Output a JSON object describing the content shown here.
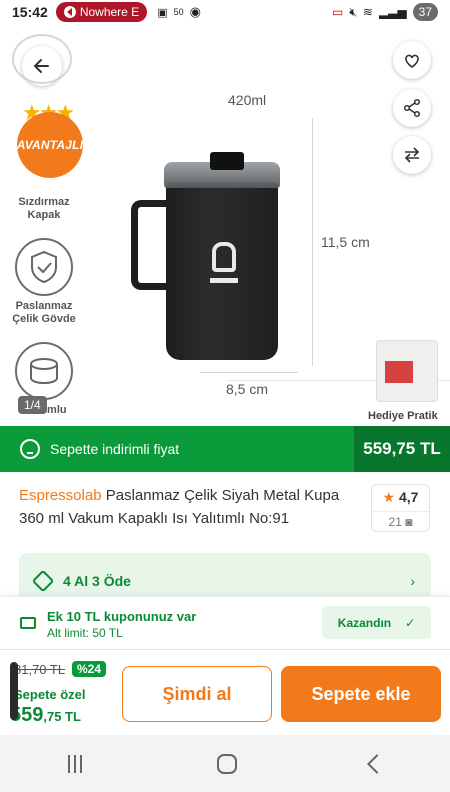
{
  "status": {
    "time": "15:42",
    "media_pill": "Nowhere E",
    "badge_50": "50",
    "battery": "37"
  },
  "hero": {
    "dim_top": "420ml",
    "dim_right": "11,5 cm",
    "dim_bottom": "8,5 cm",
    "avantajli": "AVANTAJLI",
    "features": [
      {
        "label": "Sızdırmaz Kapak"
      },
      {
        "label": "Paslanmaz Çelik Gövde"
      },
      {
        "label": "Vakumlu"
      }
    ],
    "pager": "1/4",
    "gift_label": "Hediye Pratik"
  },
  "greenbar": {
    "label": "Sepette indirimli fiyat",
    "price": "559,75 TL"
  },
  "product": {
    "brand": "Espressolab",
    "title": "Paslanmaz Çelik Siyah Metal Kupa 360 ml Vakum Kapaklı Isı Yalıtımlı No:91",
    "rating": "4,7",
    "review_count": "21"
  },
  "installment": {
    "label": "4 Al 3 Öde"
  },
  "coupon": {
    "line1": "Ek 10 TL kuponunuz var",
    "line2": "Alt limit: 50 TL",
    "button": "Kazandın"
  },
  "bottom": {
    "old_price": "81,70 TL",
    "discount": "%24",
    "special_label": "Sepete özel",
    "new_price_main": "559",
    "new_price_frac": ",75 TL",
    "buy_now": "Şimdi al",
    "add_to_cart": "Sepete ekle"
  }
}
